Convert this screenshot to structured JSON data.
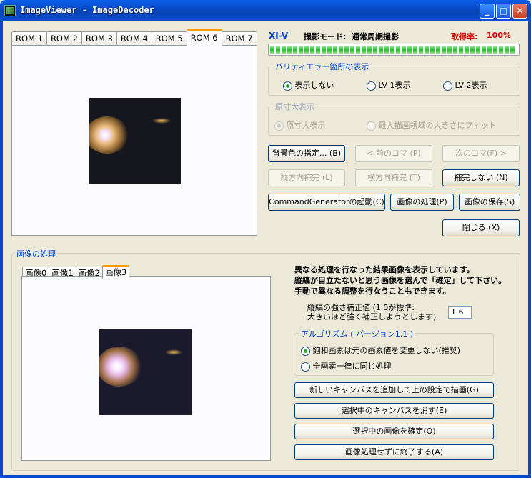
{
  "window": {
    "title": "ImageViewer - ImageDecoder",
    "minimize": "_",
    "maximize": "□",
    "close": "✕"
  },
  "rom_tabs": [
    "ROM 1",
    "ROM 2",
    "ROM 3",
    "ROM 4",
    "ROM 5",
    "ROM 6",
    "ROM 7"
  ],
  "rom_tab_selected": "ROM 6",
  "status": {
    "instrument": "XI-V",
    "mode_label": "撮影モード:",
    "mode_value": "通常周期撮影",
    "rate_label": "取得率:",
    "rate_value": "100%",
    "progress_fraction": 1.0
  },
  "parity": {
    "title": "パリティエラー箇所の表示",
    "options": [
      "表示しない",
      "LV 1表示",
      "LV 2表示"
    ],
    "selected": "表示しない"
  },
  "original_size": {
    "title": "原寸大表示",
    "options": [
      "原寸大表示",
      "最大描画領域の大きさにフィット"
    ],
    "selected": "原寸大表示"
  },
  "buttons": {
    "bg_color": "背景色の指定... (B)",
    "prev": "< 前のコマ (P)",
    "next": "次のコマ(F) >",
    "vertical": "縦方向補完 (L)",
    "horizontal": "横方向補完 (T)",
    "no_complement": "補完しない (N)",
    "command_generator": "CommandGeneratorの起動(C)",
    "image_process": "画像の処理(P)",
    "image_save": "画像の保存(S)",
    "close": "閉じる (X)"
  },
  "processing": {
    "title": "画像の処理",
    "tabs": [
      "画像0",
      "画像1",
      "画像2",
      "画像3"
    ],
    "tab_selected": "画像3",
    "desc1": "異なる処理を行なった結果画像を表示しています。",
    "desc2": "縦縞が目立たないと思う画像を選んで「確定」して下さい。",
    "desc3": "手動で異なる調整を行なうこともできます。",
    "strength_label1": "縦縞の強さ補正値 (1.0が標準:",
    "strength_label2": "大きいほど強く補正しようとします)",
    "strength_value": "1.6",
    "algorithm": {
      "title": "アルゴリズム ( バージョン1.1 )",
      "options": [
        "飽和画素は元の画素値を変更しない(推奨)",
        "全画素一律に同じ処理"
      ],
      "selected": "飽和画素は元の画素値を変更しない(推奨)"
    },
    "btn_new_canvas": "新しいキャンバスを追加して上の設定で描画(G)",
    "btn_delete_canvas": "選択中のキャンバスを消す(E)",
    "btn_confirm": "選択中の画像を確定(O)",
    "btn_finish": "画像処理せずに終了する(A)"
  },
  "colors": {
    "accent_blue": "#0046d5",
    "rate_red": "#e00000",
    "xp_title": "#0a5fe8"
  }
}
